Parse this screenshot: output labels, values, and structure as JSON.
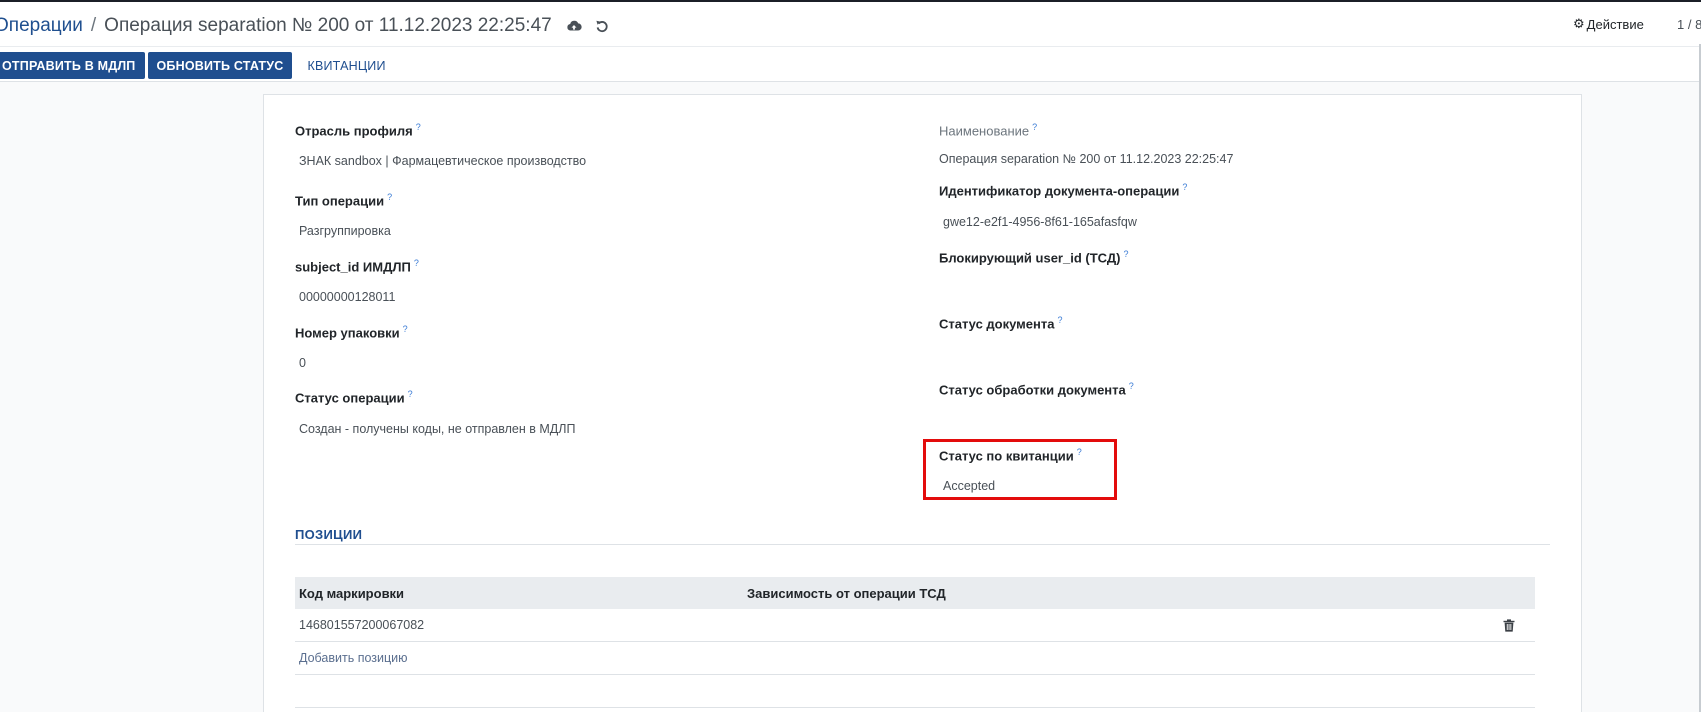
{
  "breadcrumb": {
    "parent": "Операции",
    "separator": "/",
    "current": "Операция separation № 200 от 11.12.2023 22:25:47"
  },
  "icons": {
    "save": "cloud-upload-icon",
    "discard": "undo-icon",
    "action": "gear-icon",
    "delete": "trash-icon"
  },
  "action_menu": {
    "label": "Действие"
  },
  "pager": {
    "text": "1 / 8"
  },
  "buttons": {
    "send": "ОТПРАВИТЬ В МДЛП",
    "refresh": "ОБНОВИТЬ СТАТУС",
    "receipts": "КВИТАНЦИИ"
  },
  "left_fields": [
    {
      "label": "Отрасль профиля",
      "value": "ЗНАК sandbox | Фармацевтическое производство"
    },
    {
      "label": "Тип операции",
      "value": "Разгруппировка"
    },
    {
      "label": "subject_id ИМДЛП",
      "value": "00000000128011"
    },
    {
      "label": "Номер упаковки",
      "value": "0"
    },
    {
      "label": "Статус операции",
      "value": "Создан - получены коды, не отправлен в МДЛП"
    }
  ],
  "right_fields": [
    {
      "label": "Наименование",
      "value": "Операция separation № 200 от 11.12.2023 22:25:47"
    },
    {
      "label": "Идентификатор документа-операции",
      "value": "gwe12-e2f1-4956-8f61-165afasfqw"
    },
    {
      "label": "Блокирующий user_id (ТСД)",
      "value": ""
    },
    {
      "label": "Статус документа",
      "value": ""
    },
    {
      "label": "Статус обработки документа",
      "value": ""
    },
    {
      "label": "Статус по квитанции",
      "value": "Accepted"
    }
  ],
  "help_mark": "?",
  "positions": {
    "title": "ПОЗИЦИИ",
    "columns": [
      "Код маркировки",
      "Зависимость от операции ТСД"
    ],
    "rows": [
      {
        "code": "146801557200067082",
        "dependency": ""
      }
    ],
    "add_label": "Добавить позицию"
  },
  "colors": {
    "primary": "#1f4e8f",
    "highlight": "#e30c0c"
  }
}
